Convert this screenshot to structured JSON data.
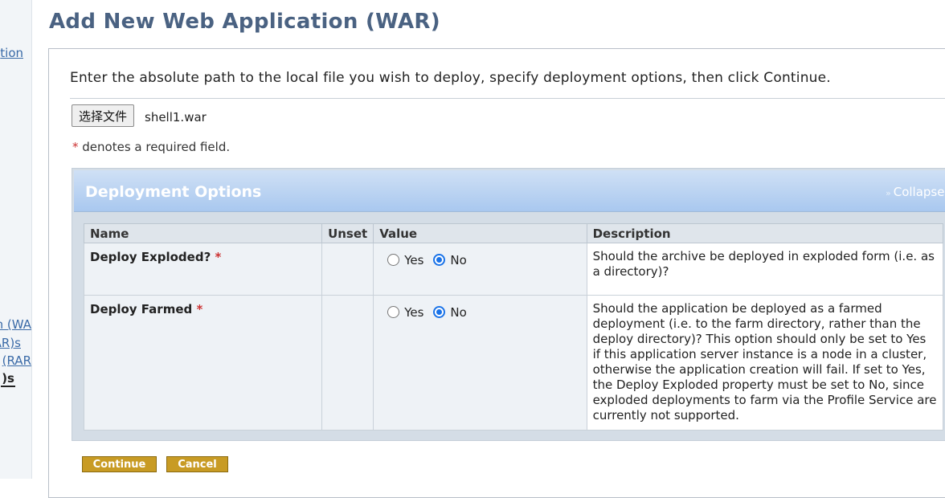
{
  "nav": {
    "item1": "tion",
    "item2": "n (WA",
    "item3": "AR)s",
    "item4": "(RAR",
    "item5": ")s"
  },
  "page": {
    "title": "Add New Web Application (WAR)",
    "intro": "Enter the absolute path to the local file you wish to deploy, specify deployment options, then click Continue."
  },
  "file": {
    "button_label": "选择文件",
    "chosen_name": "shell1.war"
  },
  "required_note": {
    "star": "*",
    "text": "denotes a required field."
  },
  "options": {
    "title": "Deployment Options",
    "collapse_label": "Collapse",
    "columns": [
      "Name",
      "Unset",
      "Value",
      "Description"
    ],
    "rows": [
      {
        "name": "Deploy Exploded?",
        "required": "*",
        "yes_label": "Yes",
        "no_label": "No",
        "selected": "No",
        "description": "Should the archive be deployed in exploded form (i.e. as a directory)?"
      },
      {
        "name": "Deploy Farmed",
        "required": "*",
        "yes_label": "Yes",
        "no_label": "No",
        "selected": "No",
        "description": "Should the application be deployed as a farmed deployment (i.e. to the farm directory, rather than the deploy directory)? This option should only be set to Yes if this application server instance is a node in a cluster, otherwise the application creation will fail. If set to Yes, the Deploy Exploded property must be set to No, since exploded deployments to farm via the Profile Service are currently not supported."
      }
    ]
  },
  "buttons": {
    "continue": "Continue",
    "cancel": "Cancel"
  },
  "colors": {
    "title": "#4a6282",
    "link": "#3a6aa7",
    "button": "#c89b24",
    "radio_checked": "#1a73e8",
    "header_gradient_top": "#cfe0f5",
    "header_gradient_bottom": "#a9c8ef"
  }
}
